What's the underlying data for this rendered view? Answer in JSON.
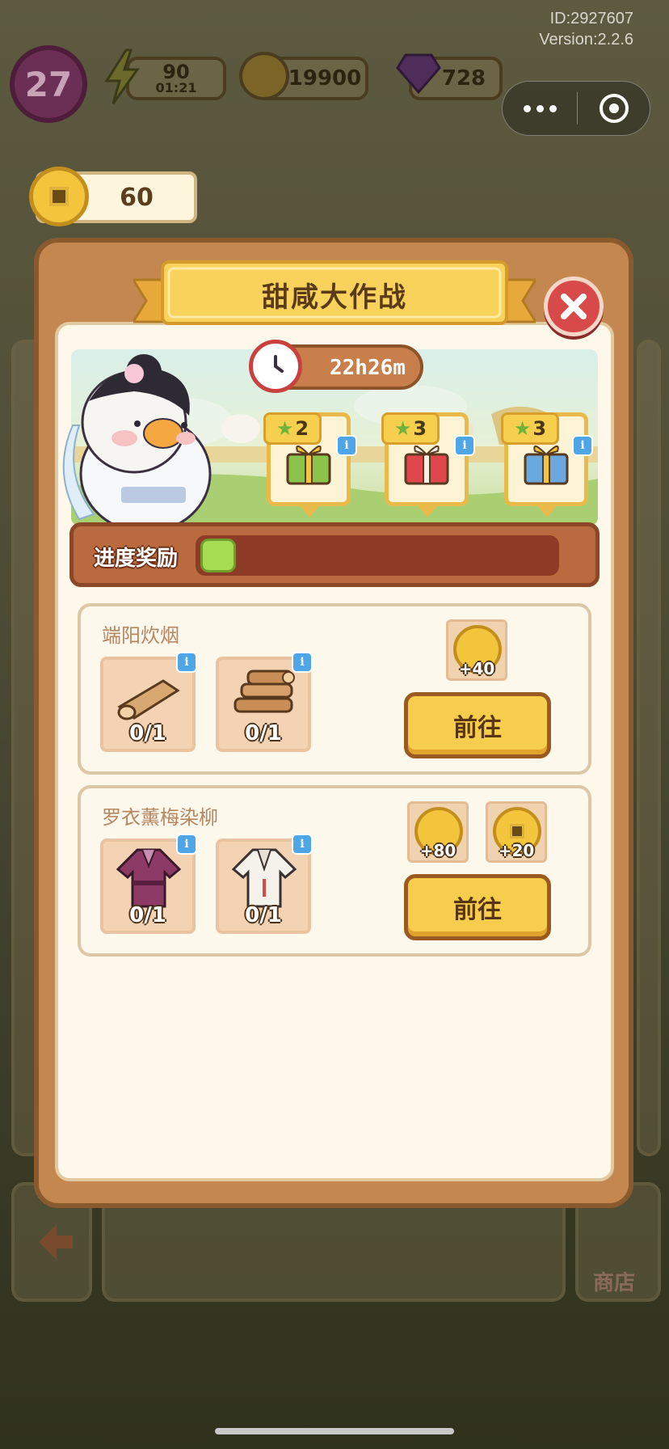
{
  "status": {
    "id_text": "ID:2927607",
    "version_text": "Version:2.2.6"
  },
  "hud": {
    "level": "27",
    "energy": "90",
    "energy_timer": "01:21",
    "coins": "19900",
    "gems": "728",
    "copper_coins": "60"
  },
  "modal": {
    "title": "甜咸大作战",
    "timer": "22h26m",
    "gifts": [
      {
        "stars": "2",
        "box_color": "#8cc34a",
        "ribbon_color": "#f4c43a"
      },
      {
        "stars": "3",
        "box_color": "#e0474c",
        "ribbon_color": "#f5f0e6"
      },
      {
        "stars": "3",
        "box_color": "#6aa8e0",
        "ribbon_color": "#f4c43a"
      }
    ],
    "progress": {
      "label": "进度奖励",
      "fraction": 0.09
    },
    "tasks": [
      {
        "title": "端阳炊烟",
        "items": [
          {
            "icon": "wood-log-icon",
            "count": "0/1"
          },
          {
            "icon": "firewood-pile-icon",
            "count": "0/1"
          }
        ],
        "rewards": [
          {
            "icon": "gold-coin-icon",
            "amount": "+40"
          }
        ],
        "button": "前往"
      },
      {
        "title": "罗衣薰梅染柳",
        "items": [
          {
            "icon": "purple-robe-icon",
            "count": "0/1"
          },
          {
            "icon": "white-robe-icon",
            "count": "0/1"
          }
        ],
        "rewards": [
          {
            "icon": "gold-coin-icon",
            "amount": "+80"
          },
          {
            "icon": "copper-coin-icon",
            "amount": "+20"
          }
        ],
        "button": "前往"
      }
    ]
  },
  "bottom": {
    "shop_label": "商店"
  },
  "colors": {
    "accent": "#f7cd4d",
    "modal_frame": "#c4874f",
    "close": "#d84a4a",
    "progress_fill": "#a6dc52"
  }
}
